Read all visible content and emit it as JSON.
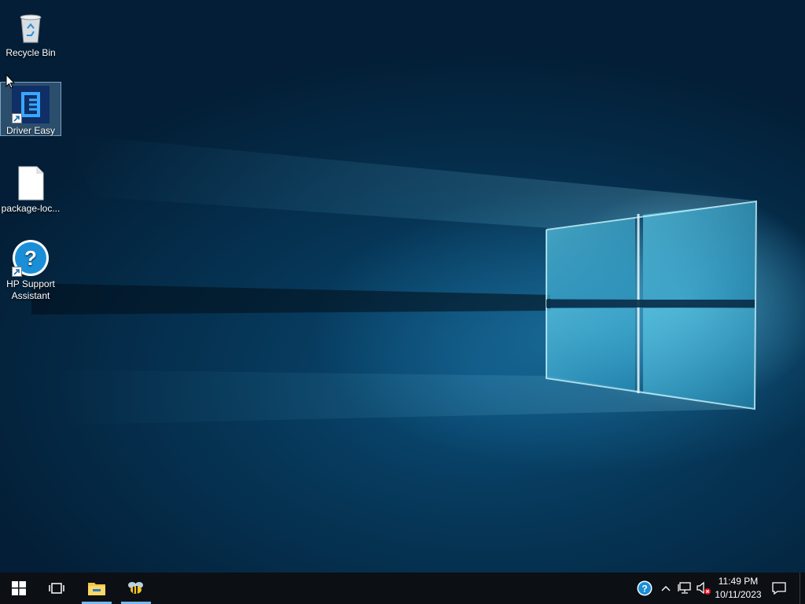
{
  "desktop": {
    "icons": [
      {
        "label": "Recycle Bin",
        "icon": "recycle-bin-icon",
        "shortcut": false,
        "selected": false
      },
      {
        "label": "Driver Easy",
        "icon": "driver-easy-icon",
        "shortcut": true,
        "selected": true
      },
      {
        "label": "package-loc...",
        "icon": "document-file-icon",
        "shortcut": false,
        "selected": false
      },
      {
        "label": "HP Support Assistant",
        "icon": "help-circle-icon",
        "shortcut": true,
        "selected": false
      }
    ]
  },
  "taskbar": {
    "start_icon": "windows-start-icon",
    "task_view_icon": "task-view-icon",
    "pinned": [
      {
        "name": "File Explorer",
        "icon": "file-explorer-icon",
        "active": true
      },
      {
        "name": "app",
        "icon": "bee-app-icon",
        "active": true
      }
    ],
    "tray": {
      "icons": [
        "hp-support-icon",
        "chevron-up-icon",
        "network-icon",
        "volume-muted-icon"
      ],
      "time": "11:49 PM",
      "date": "10/11/2023",
      "notification_icon": "action-center-icon"
    }
  },
  "colors": {
    "taskbar_bg": "#0c0f14",
    "active_indicator": "#76b9ed",
    "wallpaper_dark": "#031e36",
    "wallpaper_light": "#8ee0f5"
  }
}
